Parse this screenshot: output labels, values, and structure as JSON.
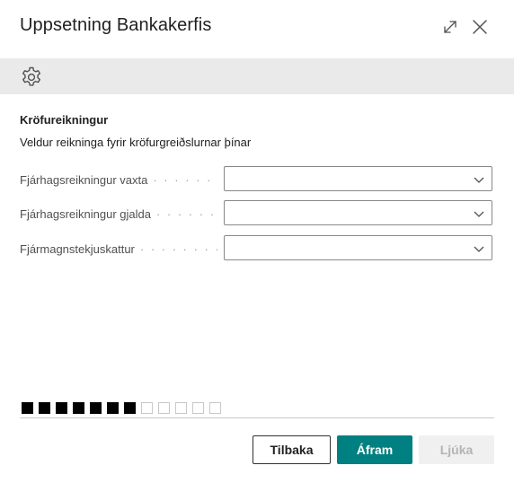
{
  "dialog": {
    "title": "Uppsetning Bankakerfis"
  },
  "toolbar": {
    "icon": "gear-icon"
  },
  "section": {
    "title": "Kröfureikningur",
    "description": "Veldur reikninga fyrir kröfurgreiðslurnar þínar"
  },
  "fields": [
    {
      "label": "Fjárhagsreikningur vaxta",
      "value": ""
    },
    {
      "label": "Fjárhagsreikningur gjalda",
      "value": ""
    },
    {
      "label": "Fjármagnstekjuskattur",
      "value": ""
    }
  ],
  "progress": {
    "completed_steps": 7,
    "total_steps": 12
  },
  "buttons": {
    "back_label": "Tilbaka",
    "next_label": "Áfram",
    "finish_label": "Ljúka"
  },
  "colors": {
    "accent": "#008080",
    "toolbar_bg": "#eaeaea",
    "disabled_bg": "#f0f0f0"
  }
}
